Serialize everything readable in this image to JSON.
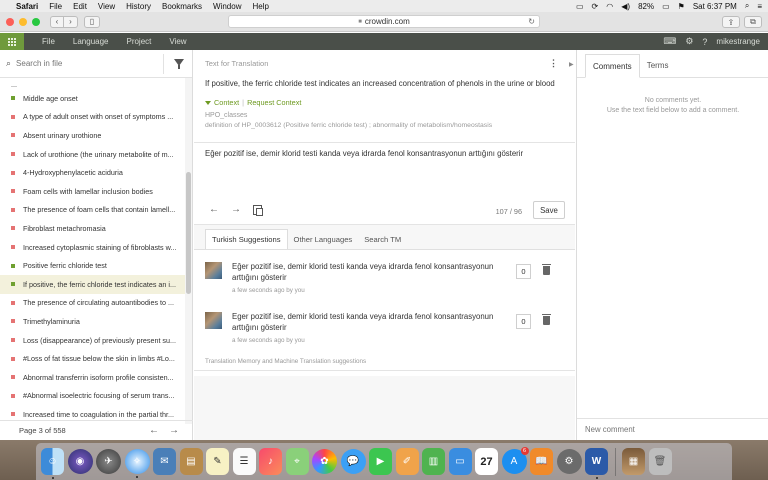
{
  "menubar": {
    "app": "Safari",
    "items": [
      "File",
      "Edit",
      "View",
      "History",
      "Bookmarks",
      "Window",
      "Help"
    ],
    "battery": "82%",
    "clock": "Sat 6:37 PM"
  },
  "browser": {
    "url": "crowdin.com"
  },
  "appbar": {
    "menu": [
      "File",
      "Language",
      "Project",
      "View"
    ],
    "username": "mikestrange"
  },
  "left": {
    "search_placeholder": "Search in file",
    "partial_item": "...",
    "items": [
      {
        "text": "Middle age onset",
        "color": "#6fa030"
      },
      {
        "text": "A type of adult onset with onset of symptoms ...",
        "color": "#e57373"
      },
      {
        "text": "Absent urinary urothione",
        "color": "#e57373"
      },
      {
        "text": "Lack of urothione (the urinary metabolite of m...",
        "color": "#e57373"
      },
      {
        "text": "4-Hydroxyphenylacetic aciduria",
        "color": "#e57373"
      },
      {
        "text": "Foam cells with lamellar inclusion bodies",
        "color": "#e57373"
      },
      {
        "text": "The presence of foam cells that contain lamell...",
        "color": "#e57373"
      },
      {
        "text": "Fibroblast metachromasia",
        "color": "#e57373"
      },
      {
        "text": "Increased cytoplasmic staining of fibroblasts w...",
        "color": "#e57373"
      },
      {
        "text": "Positive ferric chloride test",
        "color": "#6fa030"
      },
      {
        "text": "If positive, the ferric chloride test indicates an i...",
        "color": "#6fa030",
        "selected": true
      },
      {
        "text": "The presence of circulating autoantibodies to ...",
        "color": "#e57373"
      },
      {
        "text": "Trimethylaminuria",
        "color": "#e57373"
      },
      {
        "text": "Loss (disappearance) of previously present su...",
        "color": "#e57373"
      },
      {
        "text": "#Loss of fat tissue below the skin in limbs #Lo...",
        "color": "#e57373"
      },
      {
        "text": "Abnormal transferrin isoform profile consisten...",
        "color": "#e57373"
      },
      {
        "text": "#Abnormal isoelectric focusing of serum trans...",
        "color": "#e57373"
      },
      {
        "text": "Increased time to coagulation in the partial thr...",
        "color": "#e57373"
      }
    ],
    "page_label": "Page 3 of 558"
  },
  "center": {
    "source_header": "Text for Translation",
    "source_text": "If positive, the ferric chloride test indicates an increased concentration of phenols in the urine or blood",
    "context_link": "Context",
    "request_context_link": "Request Context",
    "context_line1": "HPO_classes",
    "context_line2": "definition of HP_0003612 (Positive ferric chloride test) ; abnormality of metabolism/homeostasis",
    "translation_text": "Eğer pozitif ise, demir klorid testi kanda veya idrarda fenol konsantrasyonun arttığını gösterir",
    "counter": "107 / 96",
    "save_label": "Save",
    "tabs": [
      "Turkish Suggestions",
      "Other Languages",
      "Search TM"
    ],
    "suggestions": [
      {
        "text": "Eğer pozitif ise, demir klorid testi kanda veya idrarda fenol konsantrasyonun arttığını gösterir",
        "meta": "a few seconds ago by you",
        "votes": "0"
      },
      {
        "text": "Eger pozitif ise, demir klorid testi kanda veya idrarda fenol konsantrasyonun arttığını gösterir",
        "meta": "a few seconds ago by you",
        "votes": "0"
      }
    ],
    "tm_label": "Translation Memory and Machine Translation suggestions"
  },
  "right": {
    "tabs": [
      "Comments",
      "Terms"
    ],
    "no_comments_line1": "No comments yet.",
    "no_comments_line2": "Use the text field below to add a comment.",
    "new_comment_placeholder": "New comment"
  },
  "dock": {
    "calendar_day": "27",
    "appstore_badge": "6"
  }
}
